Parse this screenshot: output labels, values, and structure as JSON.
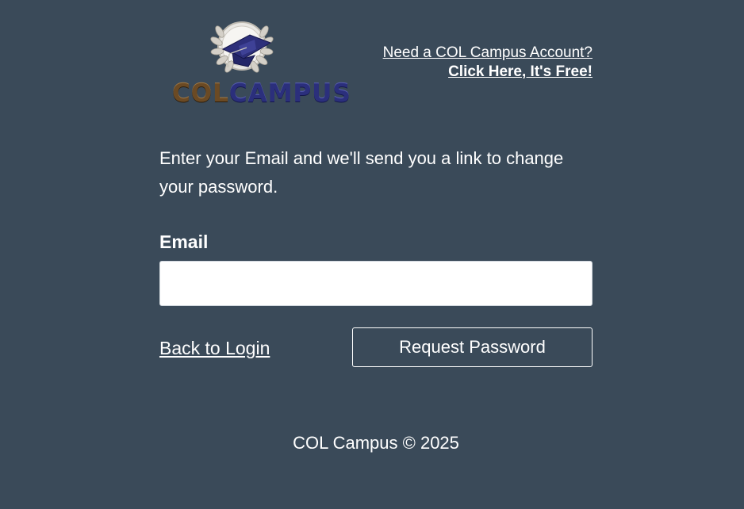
{
  "logo": {
    "word_part1": "COL",
    "word_part2": "CAMPUS",
    "colors": {
      "col": "#6b4a24",
      "campus": "#2b2f7c",
      "laurel": "#d9d6cf"
    }
  },
  "signup": {
    "line1": "Need a COL Campus Account?",
    "line2": "Click Here, It's Free!"
  },
  "form": {
    "instructions": "Enter your Email and we'll send you a link to change your password.",
    "email_label": "Email",
    "email_value": "",
    "email_placeholder": "",
    "back_link": "Back to Login",
    "submit_label": "Request Password"
  },
  "footer": {
    "text": "COL Campus © 2025"
  },
  "theme": {
    "background": "#3a4a59",
    "text": "#ffffff"
  }
}
